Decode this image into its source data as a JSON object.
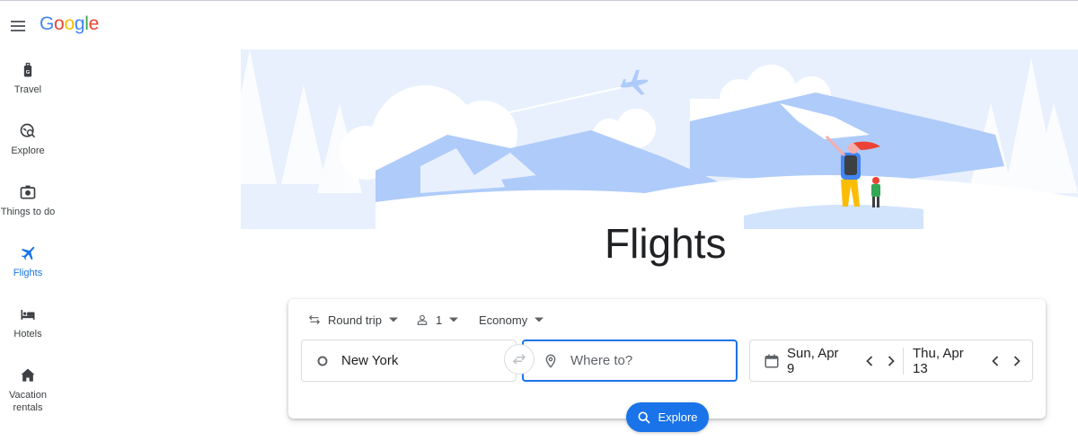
{
  "header": {
    "logo_letters": [
      {
        "ch": "G",
        "color": "#4285F4"
      },
      {
        "ch": "o",
        "color": "#EA4335"
      },
      {
        "ch": "o",
        "color": "#FBBC05"
      },
      {
        "ch": "g",
        "color": "#4285F4"
      },
      {
        "ch": "l",
        "color": "#34A853"
      },
      {
        "ch": "e",
        "color": "#EA4335"
      }
    ],
    "menu_icon": "hamburger-menu-icon"
  },
  "sidebar": {
    "items": [
      {
        "label": "Travel",
        "icon": "luggage-icon"
      },
      {
        "label": "Explore",
        "icon": "globe-search-icon"
      },
      {
        "label": "Things to do",
        "icon": "camera-icon"
      },
      {
        "label": "Flights",
        "icon": "airplane-icon",
        "active": true
      },
      {
        "label": "Hotels",
        "icon": "bed-icon"
      },
      {
        "label": "Vacation\nrentals",
        "icon": "house-icon"
      }
    ]
  },
  "main": {
    "title": "Flights"
  },
  "search": {
    "trip_type": "Round trip",
    "passengers": "1",
    "cabin_class": "Economy",
    "origin": "New York",
    "destination_placeholder": "Where to?",
    "depart_date": "Sun, Apr 9",
    "return_date": "Thu, Apr 13",
    "explore_label": "Explore"
  },
  "colors": {
    "accent": "#1a73e8",
    "illustration_blue": "#aecbfa",
    "illustration_light": "#e8f0fe"
  }
}
